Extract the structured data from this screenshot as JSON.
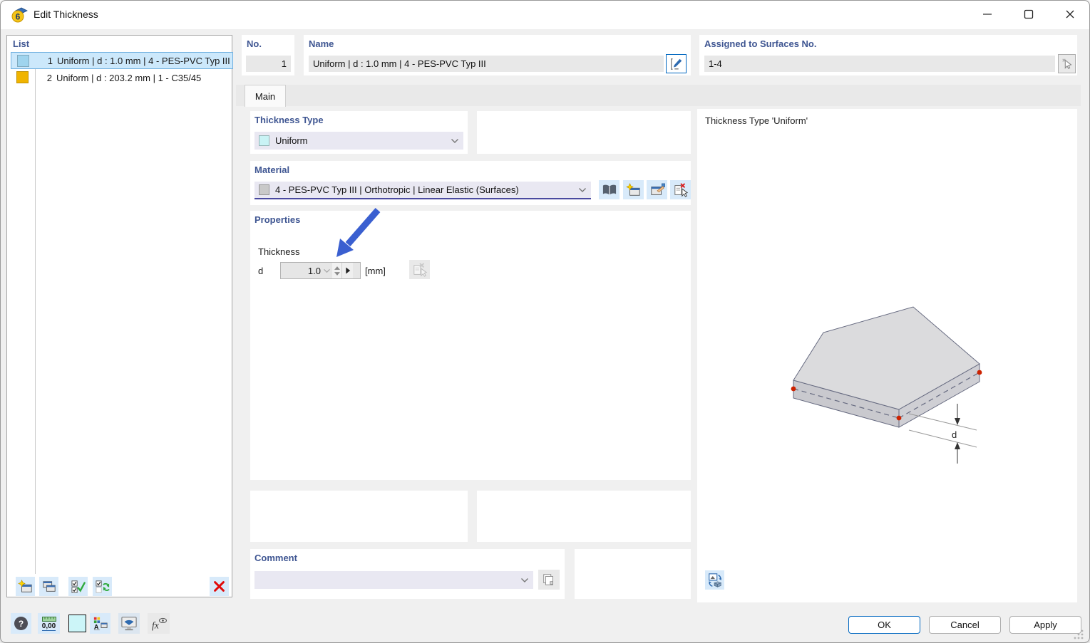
{
  "window": {
    "title": "Edit Thickness"
  },
  "list_panel": {
    "label": "List",
    "items": [
      {
        "no": "1",
        "text": "Uniform | d : 1.0 mm | 4 - PES-PVC Typ III",
        "swatch": "#9fd4ee",
        "selected": true
      },
      {
        "no": "2",
        "text": "Uniform | d : 203.2 mm | 1 - C35/45",
        "swatch": "#f0b400",
        "selected": false
      }
    ]
  },
  "header": {
    "no_label": "No.",
    "no_value": "1",
    "name_label": "Name",
    "name_value": "Uniform | d : 1.0 mm | 4 - PES-PVC Typ III",
    "assigned_label": "Assigned to Surfaces No.",
    "assigned_value": "1-4"
  },
  "tabs": {
    "main_label": "Main"
  },
  "main": {
    "thickness_type": {
      "label": "Thickness Type",
      "value": "Uniform",
      "swatch": "#c9f3f5"
    },
    "material": {
      "label": "Material",
      "value": "4 - PES-PVC Typ III | Orthotropic | Linear Elastic (Surfaces)",
      "swatch": "#c9c9c9"
    },
    "properties": {
      "label": "Properties",
      "thickness_label": "Thickness",
      "d_label": "d",
      "d_value": "1.0",
      "unit": "[mm]"
    },
    "comment": {
      "label": "Comment",
      "value": ""
    }
  },
  "preview": {
    "caption": "Thickness Type  'Uniform'",
    "dimension_label": "d"
  },
  "toolbar": {
    "help_glyph": "?",
    "units_label": "0,00",
    "display_letter": "A",
    "fx_label": "fx"
  },
  "footer": {
    "ok_label": "OK",
    "cancel_label": "Cancel",
    "apply_label": "Apply"
  },
  "colors": {
    "accent": "#0067c0",
    "header_text": "#3f5692",
    "selection_bg": "#cce8fb",
    "annotation_arrow": "#3a5fd0"
  }
}
